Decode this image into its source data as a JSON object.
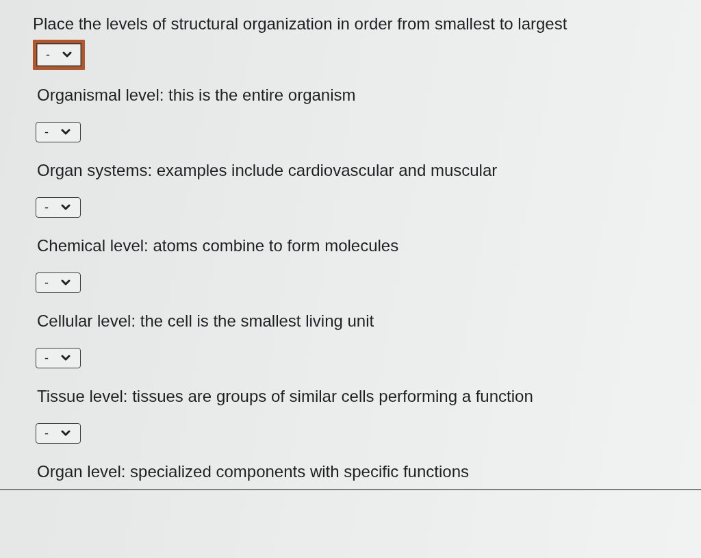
{
  "prompt": "Place the levels of structural organization in order from smallest to largest",
  "items": [
    {
      "answer": "-",
      "focused": true,
      "text": "Organismal level: this is the entire organism"
    },
    {
      "answer": "-",
      "focused": false,
      "text": "Organ systems: examples include cardiovascular and muscular"
    },
    {
      "answer": "-",
      "focused": false,
      "text": "Chemical level: atoms combine to form molecules"
    },
    {
      "answer": "-",
      "focused": false,
      "text": "Cellular level: the cell is the smallest living unit"
    },
    {
      "answer": "-",
      "focused": false,
      "text": "Tissue level: tissues are groups of similar cells performing a function"
    },
    {
      "answer": "-",
      "focused": false,
      "text": "Organ level: specialized components with specific functions"
    }
  ]
}
